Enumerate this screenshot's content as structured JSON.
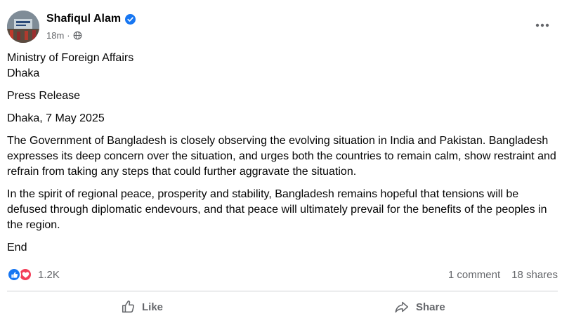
{
  "post": {
    "author": "Shafiqul Alam",
    "time": "18m",
    "separator": "·",
    "verified_icon": "verified-badge-icon",
    "privacy_icon": "globe-icon",
    "menu_icon": "more-options-icon",
    "paragraphs": [
      "Ministry of Foreign Affairs",
      "Dhaka",
      "Press Release",
      "Dhaka, 7 May 2025",
      "The Government of Bangladesh is closely observing the evolving situation in India and Pakistan. Bangladesh expresses its deep concern over the situation, and urges both the countries to remain calm, show restraint and refrain from taking any steps that could further aggravate the situation.",
      "In the spirit of regional peace, prosperity and stability, Bangladesh remains hopeful that tensions will be defused through diplomatic endevours, and that peace will ultimately prevail for the benefits of the peoples in the region.",
      "End"
    ]
  },
  "engagement": {
    "reaction_icons": [
      "like-reaction-icon",
      "love-reaction-icon"
    ],
    "reactions_count": "1.2K",
    "comments": "1 comment",
    "shares": "18 shares"
  },
  "actions": {
    "like_label": "Like",
    "share_label": "Share"
  },
  "colors": {
    "accent": "#1877f2",
    "love": "#f33e58",
    "secondary_text": "#65676b",
    "divider": "#ced0d4"
  }
}
